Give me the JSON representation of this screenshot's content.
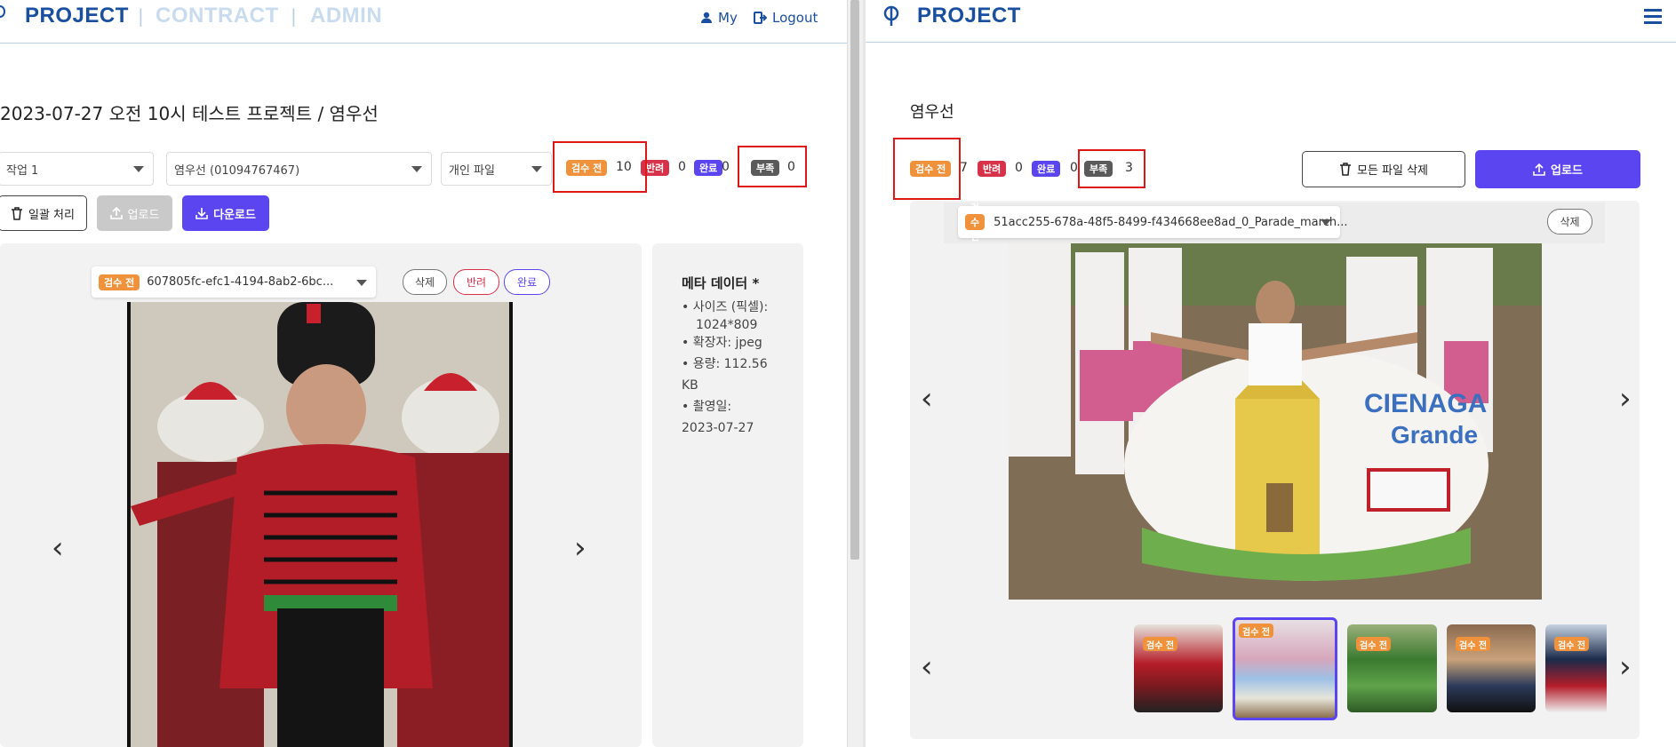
{
  "left": {
    "nav": {
      "brand_active": "PROJECT",
      "brand_contract": "CONTRACT",
      "brand_admin": "ADMIN",
      "separator": "|",
      "my_label": "My",
      "logout_label": "Logout"
    },
    "page_title": "2023-07-27 오전 10시 테스트 프로젝트 / 염우선",
    "filters": {
      "task_value": "작업 1",
      "worker_value": "염우선 (01094767467)",
      "file_type_value": "개인 파일"
    },
    "status": [
      {
        "label": "검수 전",
        "count": "10",
        "color": "#f0913b"
      },
      {
        "label": "반려",
        "count": "0",
        "color": "#d8324a"
      },
      {
        "label": "완료",
        "count": "0",
        "color": "#5b45f0"
      },
      {
        "label": "부족",
        "count": "0",
        "color": "#5a5a5a"
      }
    ],
    "actions": {
      "bulk_label": "일괄 처리",
      "upload_label": "업로드",
      "download_label": "다운로드"
    },
    "viewer": {
      "file_badge": "검수 전",
      "file_name": "607805fc-efc1-4194-8ab2-6bc...",
      "delete_label": "삭제",
      "reject_label": "반려",
      "complete_label": "완료",
      "prev": "‹",
      "next": "›"
    },
    "meta": {
      "title": "메타 데이터 *",
      "size_label": "• 사이즈 (픽셀):",
      "size_value": "1024*809",
      "ext": "• 확장자: jpeg",
      "capacity_a": "• 용량: 112.56",
      "capacity_b": "KB",
      "date_label": "• 촬영일:",
      "date_value": "2023-07-27"
    }
  },
  "right": {
    "nav": {
      "brand": "PROJECT"
    },
    "title": "염우선",
    "status": [
      {
        "label": "검수 전",
        "count": "7",
        "color": "#f0913b"
      },
      {
        "label": "반려",
        "count": "0",
        "color": "#d8324a"
      },
      {
        "label": "완료",
        "count": "0",
        "color": "#5b45f0"
      },
      {
        "label": "부족",
        "count": "3",
        "color": "#5a5a5a"
      }
    ],
    "actions": {
      "delete_all_label": "모든 파일 삭제",
      "upload_label": "업로드"
    },
    "viewer": {
      "file_badge": "검수 전",
      "file_name": "51acc255-678a-48f5-8499-f434668ee8ad_0_Parade_march...",
      "delete_label": "삭제",
      "prev": "‹",
      "next": "›"
    },
    "thumbnails": [
      {
        "badge": "검수 전"
      },
      {
        "badge": "검수 전"
      },
      {
        "badge": "검수 전"
      },
      {
        "badge": "검수 전"
      },
      {
        "badge": "검수 전"
      }
    ]
  }
}
